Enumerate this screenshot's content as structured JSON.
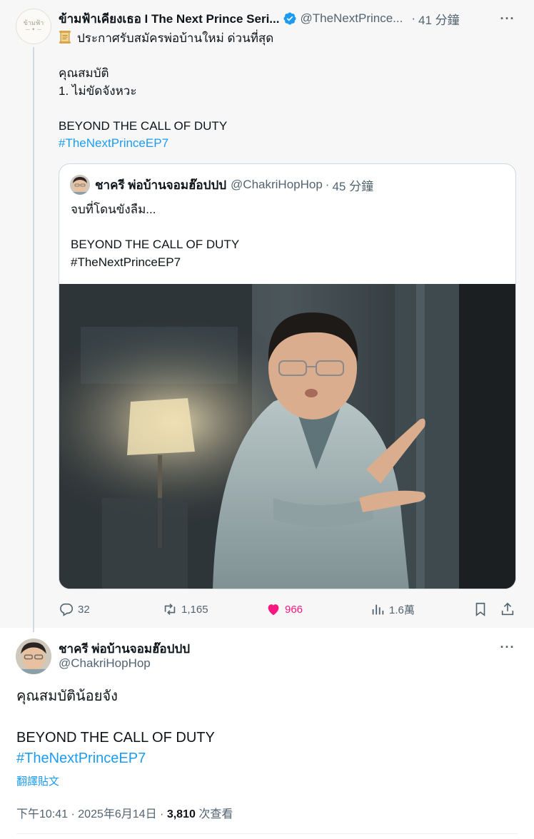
{
  "parent_tweet": {
    "author_name": "ข้ามฟ้าเคียงเธอ I The Next Prince Seri...",
    "author_handle": "@TheNextPrince...",
    "time": "41 分鐘",
    "avatar_logo_text": "ข้ามฟ้า",
    "lines": [
      "ประกาศรับสมัครพ่อบ้านใหม่ ด่วนที่สุด",
      "",
      "คุณสมบัติ",
      "1. ไม่ขัดจังหวะ",
      "",
      "BEYOND THE CALL OF DUTY"
    ],
    "hashtag": "#TheNextPrinceEP7",
    "quoted": {
      "author_name": "ชาครี พ่อบ้านจอมฮ๊อปปป",
      "author_handle": "@ChakriHopHop",
      "time": "45 分鐘",
      "lines": [
        "จบที่โดนขังลืม...",
        "",
        "BEYOND THE CALL OF DUTY",
        "#TheNextPrinceEP7"
      ]
    },
    "stats": {
      "replies": "32",
      "retweets": "1,165",
      "likes": "966",
      "views": "1.6萬"
    }
  },
  "main_tweet": {
    "author_name": "ชาครี พ่อบ้านจอมฮ๊อปปป",
    "author_handle": "@ChakriHopHop",
    "lines": [
      "คุณสมบัติน้อยจัง",
      "",
      "BEYOND THE CALL OF DUTY"
    ],
    "hashtag": "#TheNextPrinceEP7",
    "translate_label": "翻譯貼文",
    "time": "下午10:41",
    "date": "2025年6月14日",
    "views_count": "3,810",
    "views_label": "次查看"
  },
  "icons": {
    "more": "more-horizontal-icon",
    "verified": "verified-badge-icon",
    "reply": "reply-icon",
    "retweet": "retweet-icon",
    "like": "heart-filled-icon",
    "views": "analytics-icon",
    "bookmark": "bookmark-icon",
    "share": "share-icon"
  },
  "colors": {
    "link": "#1d9bf0",
    "like": "#f91880",
    "muted": "#536471",
    "text": "#0f1419"
  }
}
